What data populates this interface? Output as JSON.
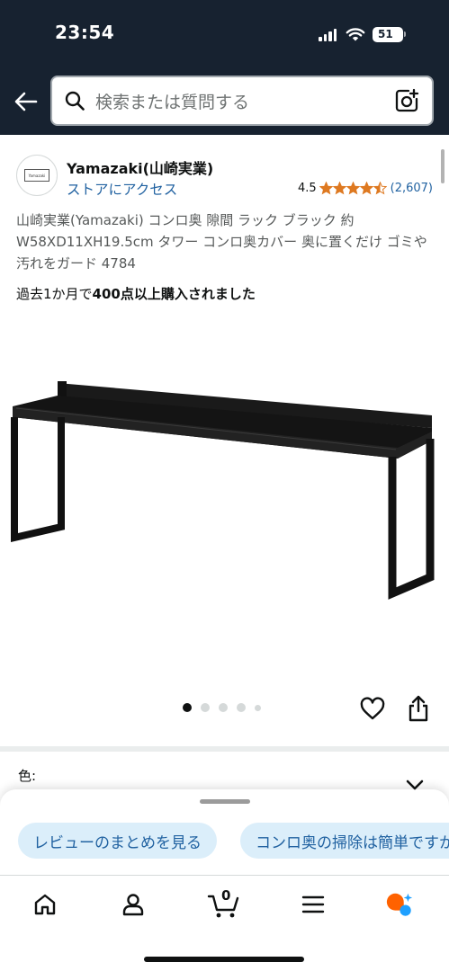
{
  "status_bar": {
    "time": "23:54",
    "battery": "51"
  },
  "search": {
    "placeholder": "検索または質問する",
    "back_icon": "arrow-left-icon",
    "search_icon": "magnifier-icon",
    "camera_icon": "camera-lens-icon"
  },
  "brand": {
    "name": "Yamazaki(山崎実業)",
    "store_link": "ストアにアクセス",
    "logo_text": "Yamazaki"
  },
  "rating": {
    "value": "4.5",
    "stars": 4.5,
    "count": "(2,607)",
    "star_color": "#de7921"
  },
  "product": {
    "title": "山崎実業(Yamazaki) コンロ奥 隙間 ラック ブラック 約W58XD11XH19.5cm タワー コンロ奥カバー 奥に置くだけ ゴミや汚れをガード 4784",
    "purchased_prefix": "過去1か月で",
    "purchased_bold": "400点以上購入されました",
    "image_description_icon": "stove-rack-image"
  },
  "carousel": {
    "total": 5,
    "active_index": 0
  },
  "actions": {
    "favorite_icon": "heart-icon",
    "share_icon": "share-icon"
  },
  "variation": {
    "color_label": "色:"
  },
  "sheet": {
    "chips": [
      "レビューのまとめを見る",
      "コンロ奥の掃除は簡単ですか"
    ]
  },
  "nav": {
    "items": [
      {
        "name": "home",
        "icon": "home-icon"
      },
      {
        "name": "account",
        "icon": "person-icon"
      },
      {
        "name": "cart",
        "icon": "cart-icon",
        "count": "0"
      },
      {
        "name": "menu",
        "icon": "hamburger-icon"
      },
      {
        "name": "rufus",
        "icon": "rufus-assistant-icon"
      }
    ]
  },
  "colors": {
    "header_bg": "#172230",
    "link": "#2162a1",
    "chip_bg": "#dbeefa",
    "accent_orange": "#ff6200",
    "accent_blue": "#1ea0ff"
  }
}
